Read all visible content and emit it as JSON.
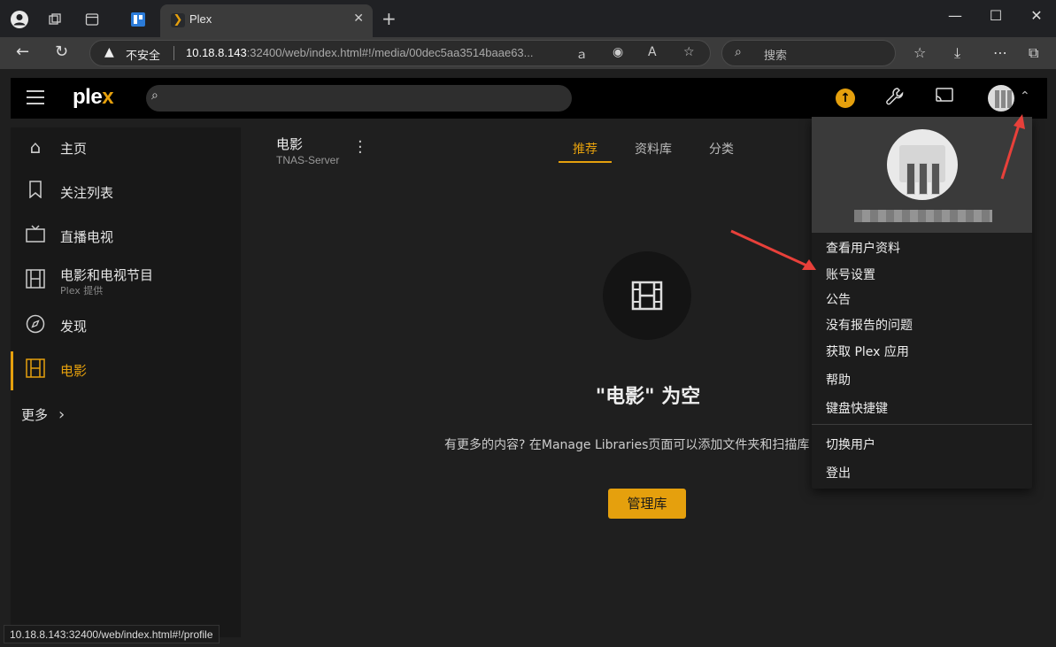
{
  "browser": {
    "tab_title": "Plex",
    "insecure_label": "不安全",
    "url_host": "10.18.8.143",
    "url_rest": ":32400/web/index.html#!/media/00dec5aa3514baae63...",
    "search_placeholder": "搜索",
    "status_url": "10.18.8.143:32400/web/index.html#!/profile"
  },
  "plex": {
    "logo_main": "ple",
    "logo_accent": "x",
    "sidebar": [
      {
        "label": "主页",
        "icon": "home-icon"
      },
      {
        "label": "关注列表",
        "icon": "bookmark-icon"
      },
      {
        "label": "直播电视",
        "icon": "tv-icon"
      },
      {
        "label": "电影和电视节目",
        "sub": "Plex 提供",
        "icon": "film-icon"
      },
      {
        "label": "发现",
        "icon": "compass-icon"
      },
      {
        "label": "电影",
        "icon": "film-icon"
      }
    ],
    "more_label": "更多",
    "library": {
      "title": "电影",
      "server": "TNAS-Server",
      "tabs": [
        "推荐",
        "资料库",
        "分类"
      ]
    },
    "empty": {
      "title": "\"电影\" 为空",
      "text": "有更多的内容? 在Manage Libraries页面可以添加文件夹和扫描库",
      "button": "管理库"
    },
    "menu": {
      "items": [
        "查看用户资料",
        "账号设置",
        "公告",
        "没有报告的问题",
        "获取 Plex 应用",
        "帮助",
        "键盘快捷键",
        "切换用户",
        "登出"
      ]
    },
    "accent_color": "#e5a00d"
  }
}
